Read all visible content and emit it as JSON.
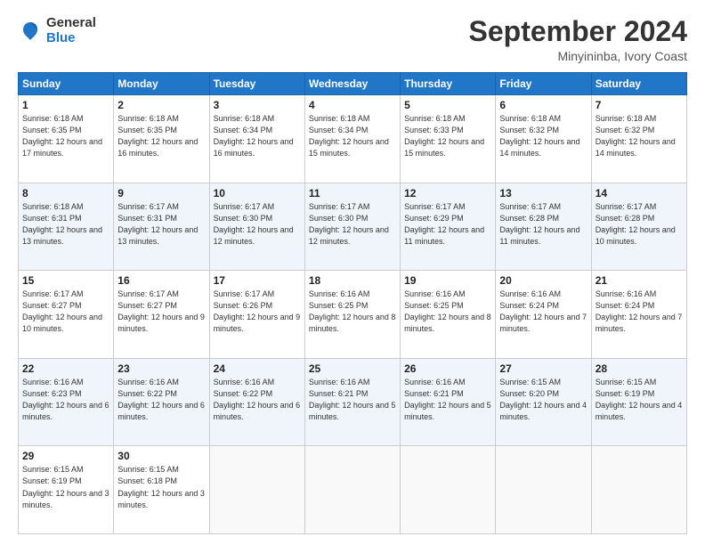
{
  "header": {
    "logo_general": "General",
    "logo_blue": "Blue",
    "month_title": "September 2024",
    "location": "Minyininba, Ivory Coast"
  },
  "calendar": {
    "days_of_week": [
      "Sunday",
      "Monday",
      "Tuesday",
      "Wednesday",
      "Thursday",
      "Friday",
      "Saturday"
    ],
    "weeks": [
      [
        null,
        {
          "day": "2",
          "sunrise": "6:18 AM",
          "sunset": "6:35 PM",
          "daylight": "12 hours and 16 minutes."
        },
        {
          "day": "3",
          "sunrise": "6:18 AM",
          "sunset": "6:34 PM",
          "daylight": "12 hours and 16 minutes."
        },
        {
          "day": "4",
          "sunrise": "6:18 AM",
          "sunset": "6:34 PM",
          "daylight": "12 hours and 15 minutes."
        },
        {
          "day": "5",
          "sunrise": "6:18 AM",
          "sunset": "6:33 PM",
          "daylight": "12 hours and 15 minutes."
        },
        {
          "day": "6",
          "sunrise": "6:18 AM",
          "sunset": "6:32 PM",
          "daylight": "12 hours and 14 minutes."
        },
        {
          "day": "7",
          "sunrise": "6:18 AM",
          "sunset": "6:32 PM",
          "daylight": "12 hours and 14 minutes."
        }
      ],
      [
        {
          "day": "1",
          "sunrise": "6:18 AM",
          "sunset": "6:35 PM",
          "daylight": "12 hours and 17 minutes."
        },
        {
          "day": "9",
          "sunrise": "6:17 AM",
          "sunset": "6:31 PM",
          "daylight": "12 hours and 13 minutes."
        },
        {
          "day": "10",
          "sunrise": "6:17 AM",
          "sunset": "6:30 PM",
          "daylight": "12 hours and 12 minutes."
        },
        {
          "day": "11",
          "sunrise": "6:17 AM",
          "sunset": "6:30 PM",
          "daylight": "12 hours and 12 minutes."
        },
        {
          "day": "12",
          "sunrise": "6:17 AM",
          "sunset": "6:29 PM",
          "daylight": "12 hours and 11 minutes."
        },
        {
          "day": "13",
          "sunrise": "6:17 AM",
          "sunset": "6:28 PM",
          "daylight": "12 hours and 11 minutes."
        },
        {
          "day": "14",
          "sunrise": "6:17 AM",
          "sunset": "6:28 PM",
          "daylight": "12 hours and 10 minutes."
        }
      ],
      [
        {
          "day": "8",
          "sunrise": "6:18 AM",
          "sunset": "6:31 PM",
          "daylight": "12 hours and 13 minutes."
        },
        {
          "day": "16",
          "sunrise": "6:17 AM",
          "sunset": "6:27 PM",
          "daylight": "12 hours and 9 minutes."
        },
        {
          "day": "17",
          "sunrise": "6:17 AM",
          "sunset": "6:26 PM",
          "daylight": "12 hours and 9 minutes."
        },
        {
          "day": "18",
          "sunrise": "6:16 AM",
          "sunset": "6:25 PM",
          "daylight": "12 hours and 8 minutes."
        },
        {
          "day": "19",
          "sunrise": "6:16 AM",
          "sunset": "6:25 PM",
          "daylight": "12 hours and 8 minutes."
        },
        {
          "day": "20",
          "sunrise": "6:16 AM",
          "sunset": "6:24 PM",
          "daylight": "12 hours and 7 minutes."
        },
        {
          "day": "21",
          "sunrise": "6:16 AM",
          "sunset": "6:24 PM",
          "daylight": "12 hours and 7 minutes."
        }
      ],
      [
        {
          "day": "15",
          "sunrise": "6:17 AM",
          "sunset": "6:27 PM",
          "daylight": "12 hours and 10 minutes."
        },
        {
          "day": "23",
          "sunrise": "6:16 AM",
          "sunset": "6:22 PM",
          "daylight": "12 hours and 6 minutes."
        },
        {
          "day": "24",
          "sunrise": "6:16 AM",
          "sunset": "6:22 PM",
          "daylight": "12 hours and 6 minutes."
        },
        {
          "day": "25",
          "sunrise": "6:16 AM",
          "sunset": "6:21 PM",
          "daylight": "12 hours and 5 minutes."
        },
        {
          "day": "26",
          "sunrise": "6:16 AM",
          "sunset": "6:21 PM",
          "daylight": "12 hours and 5 minutes."
        },
        {
          "day": "27",
          "sunrise": "6:15 AM",
          "sunset": "6:20 PM",
          "daylight": "12 hours and 4 minutes."
        },
        {
          "day": "28",
          "sunrise": "6:15 AM",
          "sunset": "6:19 PM",
          "daylight": "12 hours and 4 minutes."
        }
      ],
      [
        {
          "day": "22",
          "sunrise": "6:16 AM",
          "sunset": "6:23 PM",
          "daylight": "12 hours and 6 minutes."
        },
        {
          "day": "30",
          "sunrise": "6:15 AM",
          "sunset": "6:18 PM",
          "daylight": "12 hours and 3 minutes."
        },
        null,
        null,
        null,
        null,
        null
      ],
      [
        {
          "day": "29",
          "sunrise": "6:15 AM",
          "sunset": "6:19 PM",
          "daylight": "12 hours and 3 minutes."
        },
        null,
        null,
        null,
        null,
        null,
        null
      ]
    ],
    "row_order": [
      [
        {
          "day": "1",
          "sunrise": "6:18 AM",
          "sunset": "6:35 PM",
          "daylight": "12 hours and 17 minutes."
        },
        {
          "day": "2",
          "sunrise": "6:18 AM",
          "sunset": "6:35 PM",
          "daylight": "12 hours and 16 minutes."
        },
        {
          "day": "3",
          "sunrise": "6:18 AM",
          "sunset": "6:34 PM",
          "daylight": "12 hours and 16 minutes."
        },
        {
          "day": "4",
          "sunrise": "6:18 AM",
          "sunset": "6:34 PM",
          "daylight": "12 hours and 15 minutes."
        },
        {
          "day": "5",
          "sunrise": "6:18 AM",
          "sunset": "6:33 PM",
          "daylight": "12 hours and 15 minutes."
        },
        {
          "day": "6",
          "sunrise": "6:18 AM",
          "sunset": "6:32 PM",
          "daylight": "12 hours and 14 minutes."
        },
        {
          "day": "7",
          "sunrise": "6:18 AM",
          "sunset": "6:32 PM",
          "daylight": "12 hours and 14 minutes."
        }
      ],
      [
        {
          "day": "8",
          "sunrise": "6:18 AM",
          "sunset": "6:31 PM",
          "daylight": "12 hours and 13 minutes."
        },
        {
          "day": "9",
          "sunrise": "6:17 AM",
          "sunset": "6:31 PM",
          "daylight": "12 hours and 13 minutes."
        },
        {
          "day": "10",
          "sunrise": "6:17 AM",
          "sunset": "6:30 PM",
          "daylight": "12 hours and 12 minutes."
        },
        {
          "day": "11",
          "sunrise": "6:17 AM",
          "sunset": "6:30 PM",
          "daylight": "12 hours and 12 minutes."
        },
        {
          "day": "12",
          "sunrise": "6:17 AM",
          "sunset": "6:29 PM",
          "daylight": "12 hours and 11 minutes."
        },
        {
          "day": "13",
          "sunrise": "6:17 AM",
          "sunset": "6:28 PM",
          "daylight": "12 hours and 11 minutes."
        },
        {
          "day": "14",
          "sunrise": "6:17 AM",
          "sunset": "6:28 PM",
          "daylight": "12 hours and 10 minutes."
        }
      ],
      [
        {
          "day": "15",
          "sunrise": "6:17 AM",
          "sunset": "6:27 PM",
          "daylight": "12 hours and 10 minutes."
        },
        {
          "day": "16",
          "sunrise": "6:17 AM",
          "sunset": "6:27 PM",
          "daylight": "12 hours and 9 minutes."
        },
        {
          "day": "17",
          "sunrise": "6:17 AM",
          "sunset": "6:26 PM",
          "daylight": "12 hours and 9 minutes."
        },
        {
          "day": "18",
          "sunrise": "6:16 AM",
          "sunset": "6:25 PM",
          "daylight": "12 hours and 8 minutes."
        },
        {
          "day": "19",
          "sunrise": "6:16 AM",
          "sunset": "6:25 PM",
          "daylight": "12 hours and 8 minutes."
        },
        {
          "day": "20",
          "sunrise": "6:16 AM",
          "sunset": "6:24 PM",
          "daylight": "12 hours and 7 minutes."
        },
        {
          "day": "21",
          "sunrise": "6:16 AM",
          "sunset": "6:24 PM",
          "daylight": "12 hours and 7 minutes."
        }
      ],
      [
        {
          "day": "22",
          "sunrise": "6:16 AM",
          "sunset": "6:23 PM",
          "daylight": "12 hours and 6 minutes."
        },
        {
          "day": "23",
          "sunrise": "6:16 AM",
          "sunset": "6:22 PM",
          "daylight": "12 hours and 6 minutes."
        },
        {
          "day": "24",
          "sunrise": "6:16 AM",
          "sunset": "6:22 PM",
          "daylight": "12 hours and 6 minutes."
        },
        {
          "day": "25",
          "sunrise": "6:16 AM",
          "sunset": "6:21 PM",
          "daylight": "12 hours and 5 minutes."
        },
        {
          "day": "26",
          "sunrise": "6:16 AM",
          "sunset": "6:21 PM",
          "daylight": "12 hours and 5 minutes."
        },
        {
          "day": "27",
          "sunrise": "6:15 AM",
          "sunset": "6:20 PM",
          "daylight": "12 hours and 4 minutes."
        },
        {
          "day": "28",
          "sunrise": "6:15 AM",
          "sunset": "6:19 PM",
          "daylight": "12 hours and 4 minutes."
        }
      ],
      [
        {
          "day": "29",
          "sunrise": "6:15 AM",
          "sunset": "6:19 PM",
          "daylight": "12 hours and 3 minutes."
        },
        {
          "day": "30",
          "sunrise": "6:15 AM",
          "sunset": "6:18 PM",
          "daylight": "12 hours and 3 minutes."
        },
        null,
        null,
        null,
        null,
        null
      ]
    ]
  }
}
